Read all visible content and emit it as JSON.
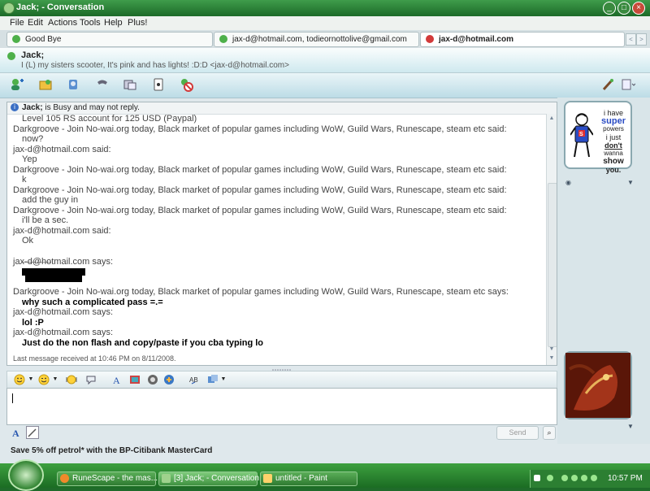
{
  "window": {
    "title": "Jack; - Conversation"
  },
  "titlebar_buttons": {
    "min": "_",
    "max": "□",
    "close": "×"
  },
  "menu": [
    "File",
    "Edit",
    "Actions",
    "Tools",
    "Help",
    "Plus!"
  ],
  "tabs": [
    {
      "label": "Good Bye",
      "status": "online"
    },
    {
      "label": "jax-d@hotmail.com, todieornottolive@gmail.com",
      "status": "online"
    },
    {
      "label": "jax-d@hotmail.com",
      "status": "busy",
      "active": true
    }
  ],
  "tab_nav": {
    "prev": "<",
    "next": ">"
  },
  "contact": {
    "name": "Jack;",
    "personal_message": "I (L) my sisters scooter, It's pink and has lights! :D:D <jax-d@hotmail.com>"
  },
  "toolbar_icons": [
    "invite-icon",
    "share-files-icon",
    "video-call-icon",
    "call-icon",
    "activities-icon",
    "games-icon",
    "block-icon",
    "paintbrush-icon",
    "layout-icon"
  ],
  "busy_notice": {
    "name": "Jack;",
    "text": "is Busy and may not reply."
  },
  "messages": [
    {
      "text": "Level 105 RS account for 125 USD (Paypal)",
      "indent": true,
      "bold": false
    },
    {
      "text": "Darkgroove - Join No-wai.org today, Black market of popular games including WoW, Guild Wars, Runescape, steam etc said:",
      "indent": false,
      "bold": false
    },
    {
      "text": "now?",
      "indent": true,
      "bold": false
    },
    {
      "text": "jax-d@hotmail.com said:",
      "indent": false,
      "bold": false
    },
    {
      "text": "Yep",
      "indent": true,
      "bold": false
    },
    {
      "text": "Darkgroove - Join No-wai.org today, Black market of popular games including WoW, Guild Wars, Runescape, steam etc said:",
      "indent": false,
      "bold": false
    },
    {
      "text": "k",
      "indent": true,
      "bold": false
    },
    {
      "text": "Darkgroove - Join No-wai.org today, Black market of popular games including WoW, Guild Wars, Runescape, steam etc said:",
      "indent": false,
      "bold": false
    },
    {
      "text": "add the guy in",
      "indent": true,
      "bold": false
    },
    {
      "text": "Darkgroove - Join No-wai.org today, Black market of popular games including WoW, Guild Wars, Runescape, steam etc said:",
      "indent": false,
      "bold": false
    },
    {
      "text": "i'll be a sec.",
      "indent": true,
      "bold": false
    },
    {
      "text": "jax-d@hotmail.com said:",
      "indent": false,
      "bold": false
    },
    {
      "text": "Ok",
      "indent": true,
      "bold": false
    },
    {
      "text": "jax-d@hotmail.com says:",
      "indent": false,
      "bold": false
    },
    {
      "text": "Darkgroove - Join No-wai.org today, Black market of popular games including WoW, Guild Wars, Runescape, steam etc says:",
      "indent": false,
      "bold": false
    },
    {
      "text": "why such a complicated pass =.=",
      "indent": true,
      "bold": true
    },
    {
      "text": "jax-d@hotmail.com says:",
      "indent": false,
      "bold": false
    },
    {
      "text": "lol :P",
      "indent": true,
      "bold": true
    },
    {
      "text": "jax-d@hotmail.com says:",
      "indent": false,
      "bold": false
    },
    {
      "text": "Just do the non flash and copy/paste if you cba typing lo",
      "indent": true,
      "bold": true
    }
  ],
  "last_received": "Last message received at 10:46 PM on 8/11/2008.",
  "format_icons": [
    "emoticon-icon",
    "wink-icon",
    "nudge-icon",
    "voice-clip-icon",
    "font-icon",
    "background-icon",
    "wink-animation-icon",
    "games-icon",
    "spell-check-icon",
    "layout-icon"
  ],
  "input": {
    "value": ""
  },
  "send_label": "Send",
  "search_glyph": "⌕",
  "mode_icons": [
    "text-mode-icon",
    "handwriting-mode-icon"
  ],
  "ad": "Save 5% off petrol* with the BP-Citibank MasterCard",
  "display_pic_top": {
    "lines": [
      "i have",
      "super",
      "powers",
      "i just",
      "don't",
      "wanna",
      "show",
      "you."
    ]
  },
  "taskbar": {
    "tasks": [
      {
        "label": "RuneScape - the mas...",
        "active": false
      },
      {
        "label": "[3] Jack; - Conversation",
        "active": true
      },
      {
        "label": "untitled - Paint",
        "active": false
      }
    ],
    "clock": "10:57 PM"
  }
}
